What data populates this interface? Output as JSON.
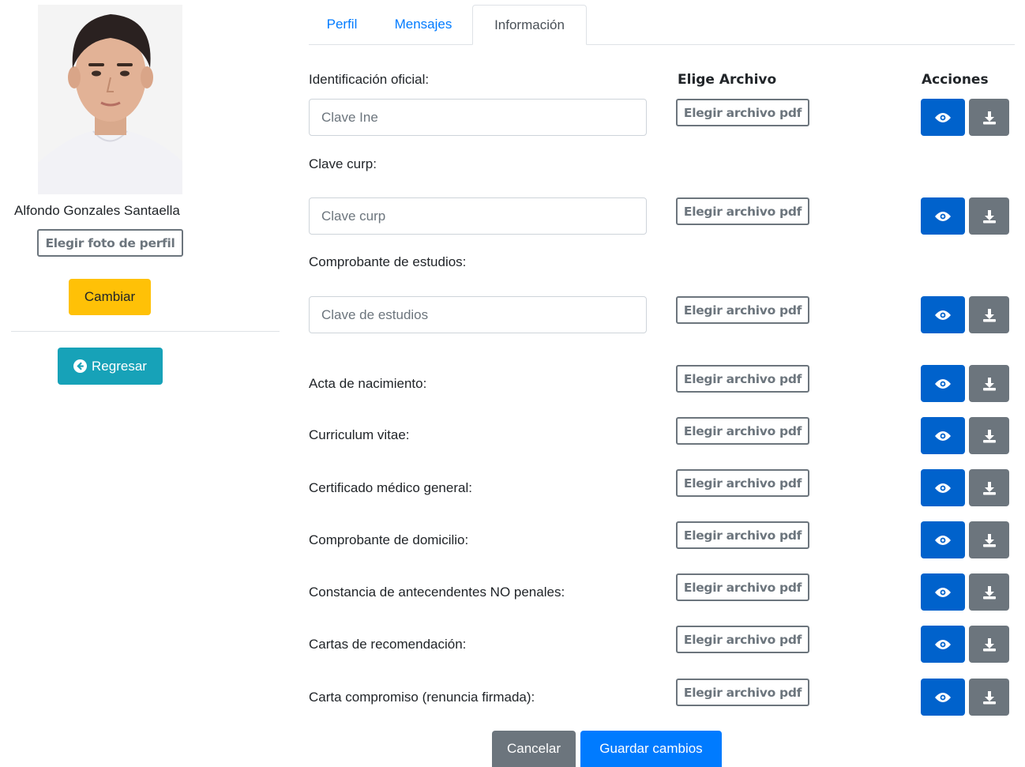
{
  "sidebar": {
    "user_name": "Alfondo Gonzales Santaella",
    "photo_button": "Elegir foto de perfil",
    "change_button": "Cambiar",
    "back_button": "Regresar"
  },
  "tabs": [
    {
      "label": "Perfil",
      "active": false
    },
    {
      "label": "Mensajes",
      "active": false
    },
    {
      "label": "Información",
      "active": true
    }
  ],
  "columns": {
    "file": "Elige Archivo",
    "actions": "Acciones"
  },
  "file_button_label": "Elegir archivo pdf",
  "documents": [
    {
      "label": "Identificación oficial:",
      "placeholder": "Clave Ine"
    },
    {
      "label": "Clave curp:",
      "placeholder": "Clave curp"
    },
    {
      "label": "Comprobante de estudios:",
      "placeholder": "Clave de estudios"
    },
    {
      "label": "Acta de nacimiento:"
    },
    {
      "label": "Curriculum vitae:"
    },
    {
      "label": "Certificado médico general:"
    },
    {
      "label": "Comprobante de domicilio:"
    },
    {
      "label": "Constancia de antecendentes NO penales:"
    },
    {
      "label": "Cartas de recomendación:"
    },
    {
      "label": "Carta compromiso (renuncia firmada):"
    }
  ],
  "footer": {
    "cancel": "Cancelar",
    "save": "Guardar cambios"
  },
  "colors": {
    "primary": "#007bff",
    "view_button": "#0062cc",
    "secondary": "#6c757d",
    "warning": "#ffc107",
    "info": "#17a2b8"
  },
  "icons": {
    "view": "eye-icon",
    "download": "download-icon",
    "back": "arrow-circle-left-icon"
  }
}
